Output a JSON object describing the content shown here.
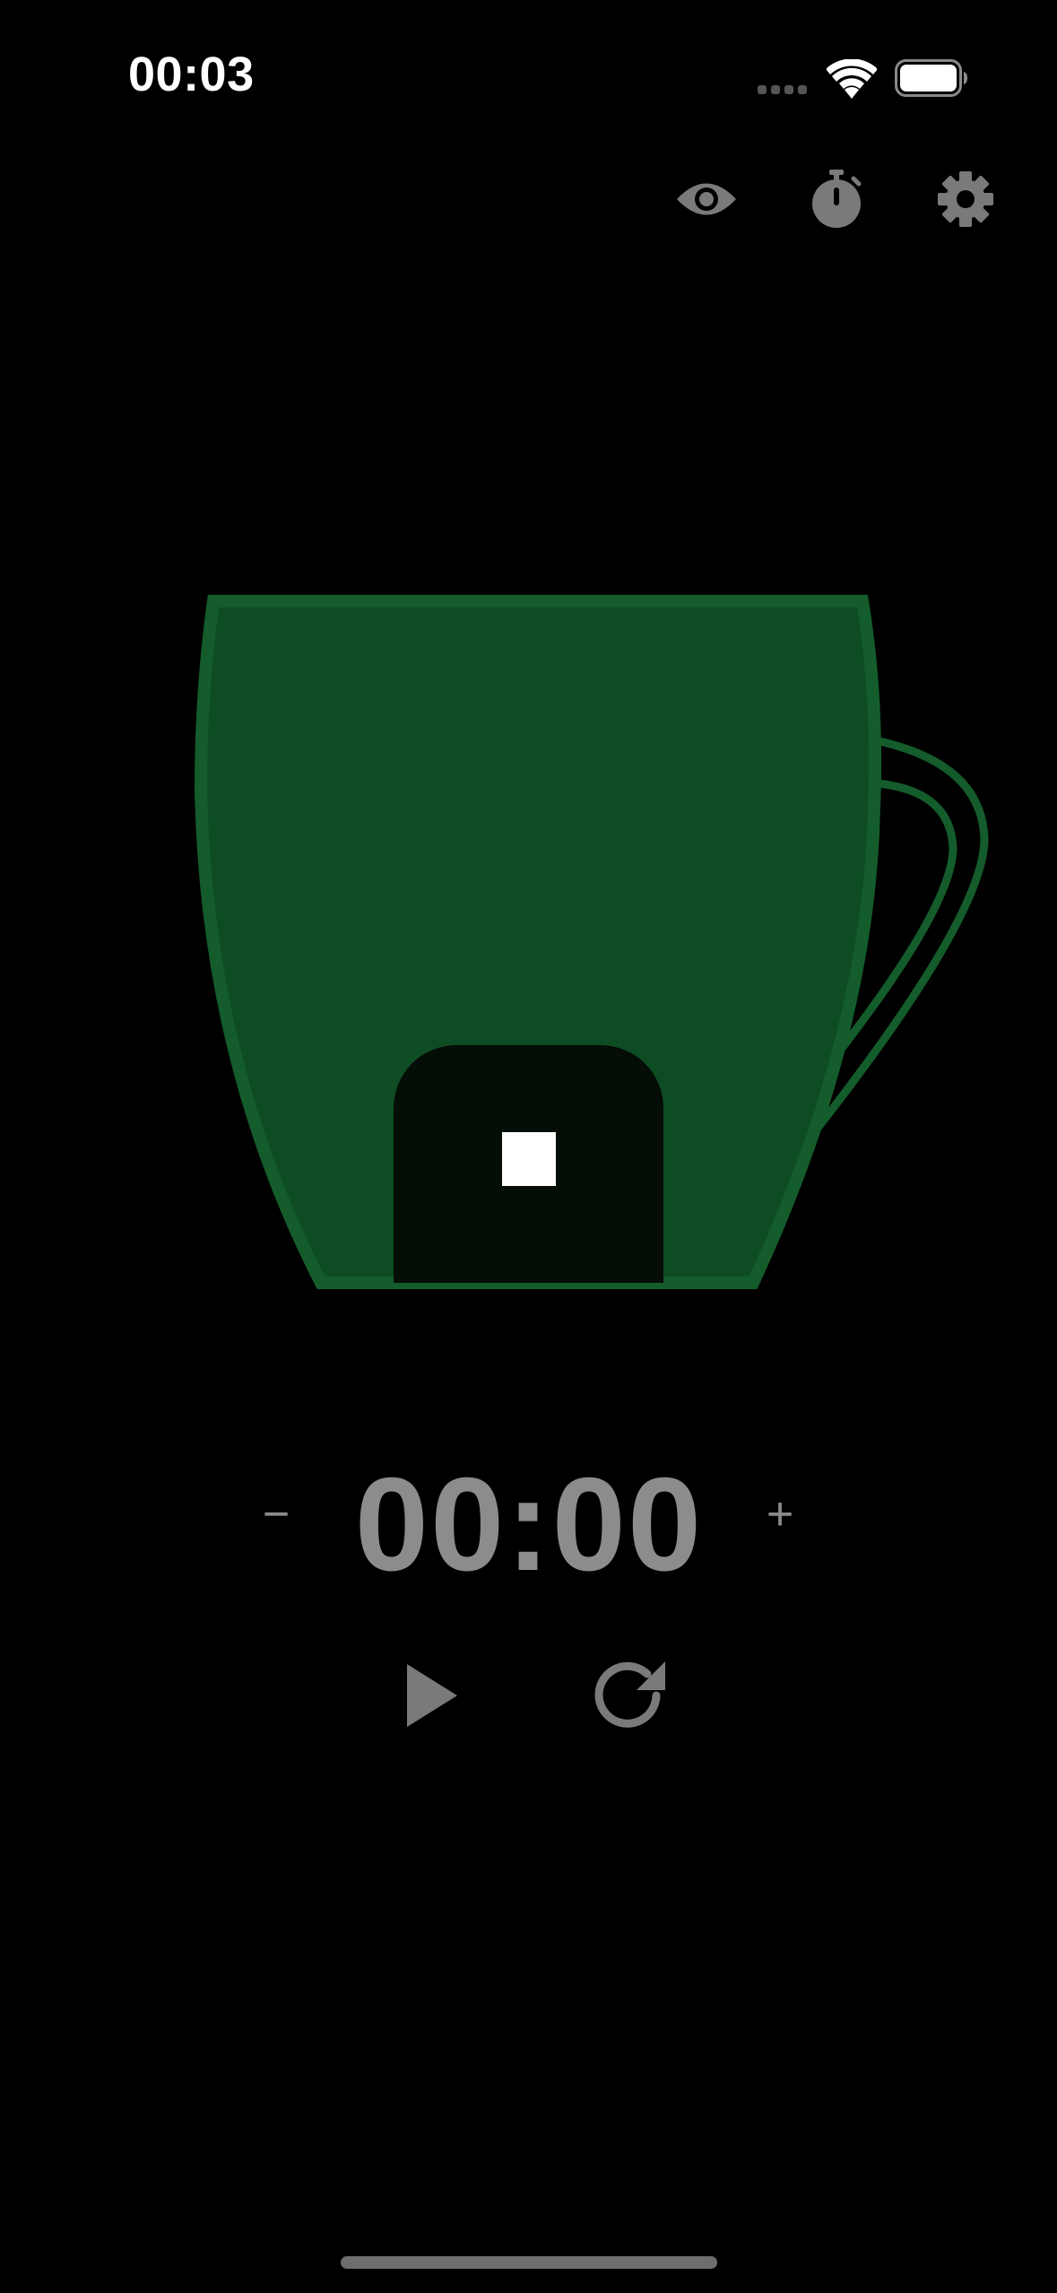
{
  "status_bar": {
    "time": "00:03"
  },
  "toolbar": {
    "icons": [
      "eye-icon",
      "timer-icon",
      "gear-icon"
    ],
    "icon_color": "#7a7a7a"
  },
  "cup": {
    "fill_color": "#0e4d23",
    "border_color": "#145c2b"
  },
  "stop_button": {
    "icon": "stop-icon"
  },
  "timer": {
    "value": "00:00",
    "minus_label": "−",
    "plus_label": "+"
  },
  "controls": {
    "play_icon": "play-icon",
    "reset_icon": "reset-icon",
    "color": "#7a7a7a"
  }
}
